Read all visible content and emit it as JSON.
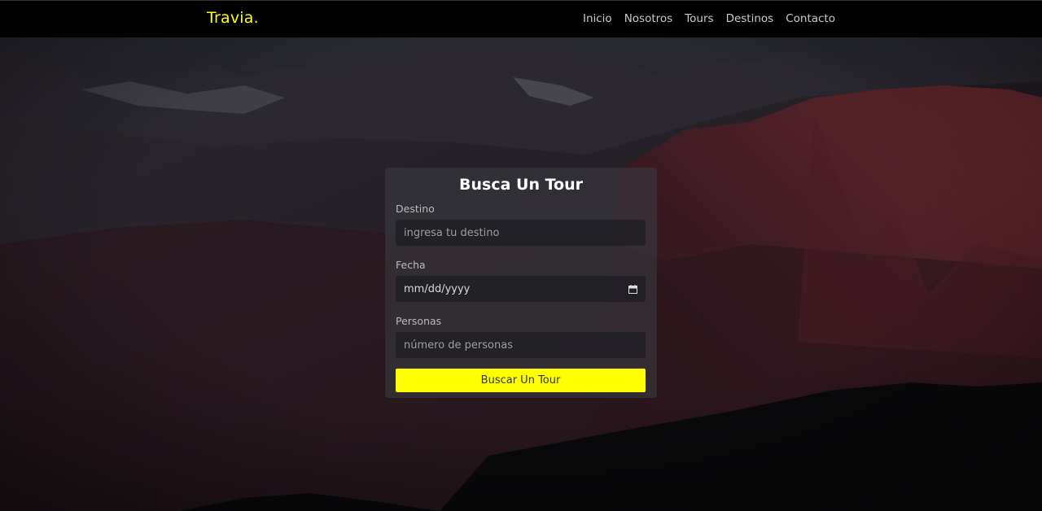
{
  "brand": "Travia.",
  "nav": {
    "items": [
      "Inicio",
      "Nosotros",
      "Tours",
      "Destinos",
      "Contacto"
    ]
  },
  "search_form": {
    "title": "Busca Un Tour",
    "destino_label": "Destino",
    "destino_placeholder": "ingresa tu destino",
    "fecha_label": "Fecha",
    "fecha_value": "mm/dd/yyyy",
    "personas_label": "Personas",
    "personas_placeholder": "número de personas",
    "submit_label": "Buscar Un Tour"
  },
  "colors": {
    "accent": "#ffff00",
    "navbar_bg": "#000000"
  }
}
